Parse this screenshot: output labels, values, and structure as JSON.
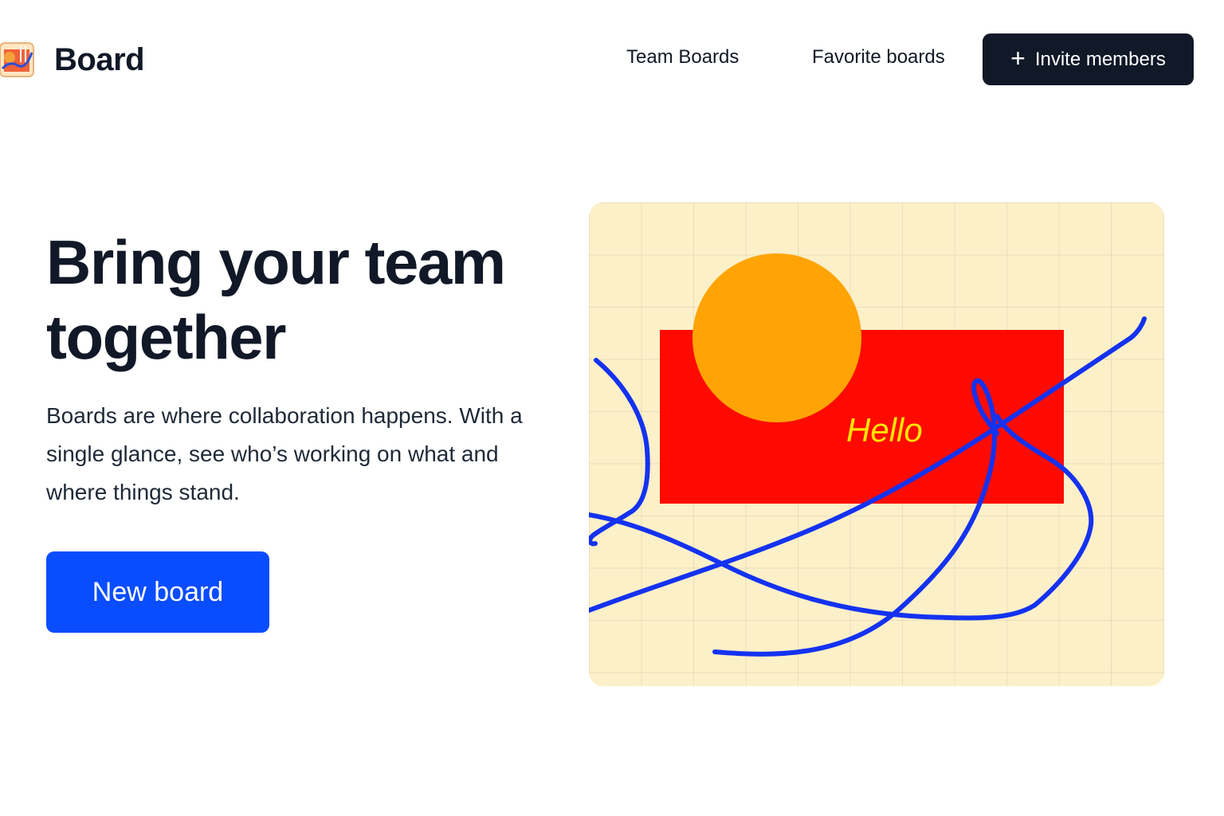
{
  "header": {
    "logo_text": "Board",
    "nav": {
      "team_boards": "Team Boards",
      "favorite_boards": "Favorite boards"
    },
    "invite_button": {
      "icon": "plus-icon",
      "label": "Invite members"
    }
  },
  "hero": {
    "title": "Bring your team together",
    "description": "Boards are where collaboration happens. With a single glance, see who’s working on what and where things stand.",
    "new_board_button": "New board"
  },
  "canvas": {
    "sticky_text": "Hello",
    "colors": {
      "background": "#fcf0c8",
      "rectangle": "#ff0a00",
      "circle": "#ffa404",
      "stroke": "#1432f0",
      "text": "#ffe400"
    }
  },
  "colors": {
    "primary_dark": "#111827",
    "primary_blue": "#0a4dff"
  }
}
